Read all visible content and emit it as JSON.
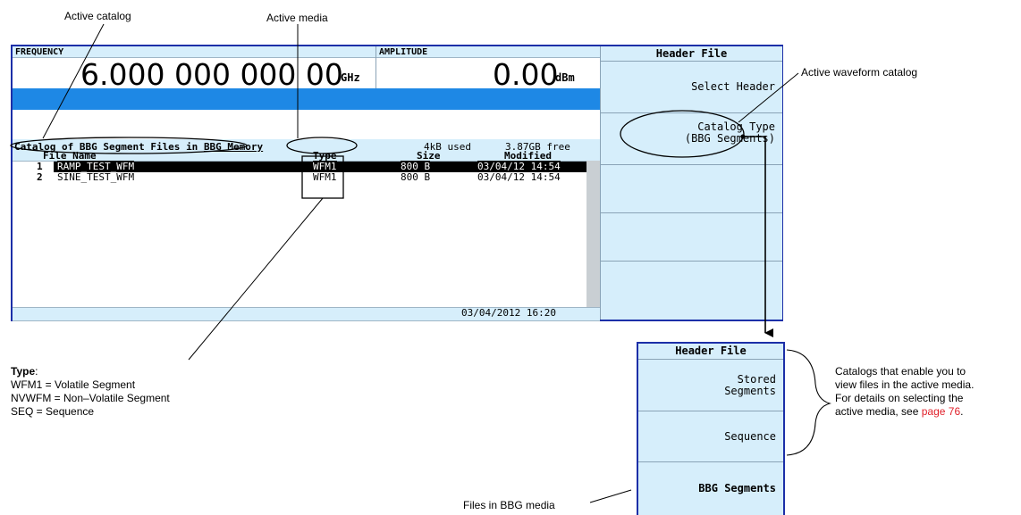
{
  "callouts": {
    "active_catalog": "Active catalog",
    "active_media": "Active media",
    "active_waveform_catalog": "Active waveform catalog",
    "files_in_bbg_media": "Files in BBG media",
    "type_title": "Type",
    "type_lines": [
      "WFM1 = Volatile Segment",
      "NVWFM = Non–Volatile Segment",
      "SEQ = Sequence"
    ],
    "catalogs_text_lines": [
      "Catalogs that enable you to",
      "view files in the active media.",
      "For details on selecting the",
      "active media, see"
    ],
    "page_link": "page 76",
    "period": "."
  },
  "screen": {
    "frequency_label": "FREQUENCY",
    "frequency_value": "6.000 000 000 00",
    "frequency_unit": "GHz",
    "amplitude_label": "AMPLITUDE",
    "amplitude_value": "0.00",
    "amplitude_unit": "dBm",
    "catalog_title": "Catalog of BBG Segment Files",
    "in_word": "in",
    "media": "BBG Memory",
    "used": "4kB used",
    "free": "3.87GB free",
    "columns": {
      "name": "File Name",
      "type": "Type",
      "size": "Size",
      "modified": "Modified"
    },
    "files": [
      {
        "index": "1",
        "name": "RAMP_TEST_WFM",
        "type": "WFM1",
        "size": "800 B",
        "modified": "03/04/12 14:54"
      },
      {
        "index": "2",
        "name": "SINE_TEST_WFM",
        "type": "WFM1",
        "size": "800 B",
        "modified": "03/04/12 14:54"
      }
    ],
    "status_datetime": "03/04/2012 16:20"
  },
  "softkeys": {
    "header": "Header File",
    "select_header": "Select Header",
    "catalog_type_line1": "Catalog Type",
    "catalog_type_line2": "(BBG Segments)"
  },
  "menu2": {
    "header": "Header File",
    "stored_line1": "Stored",
    "stored_line2": "Segments",
    "sequence": "Sequence",
    "bbg_segments": "BBG Segments"
  },
  "colors": {
    "screen_border": "#1c2fa8",
    "panel": "#d6eefb",
    "blue_bar": "#1e88e5",
    "link": "#e0202a"
  }
}
